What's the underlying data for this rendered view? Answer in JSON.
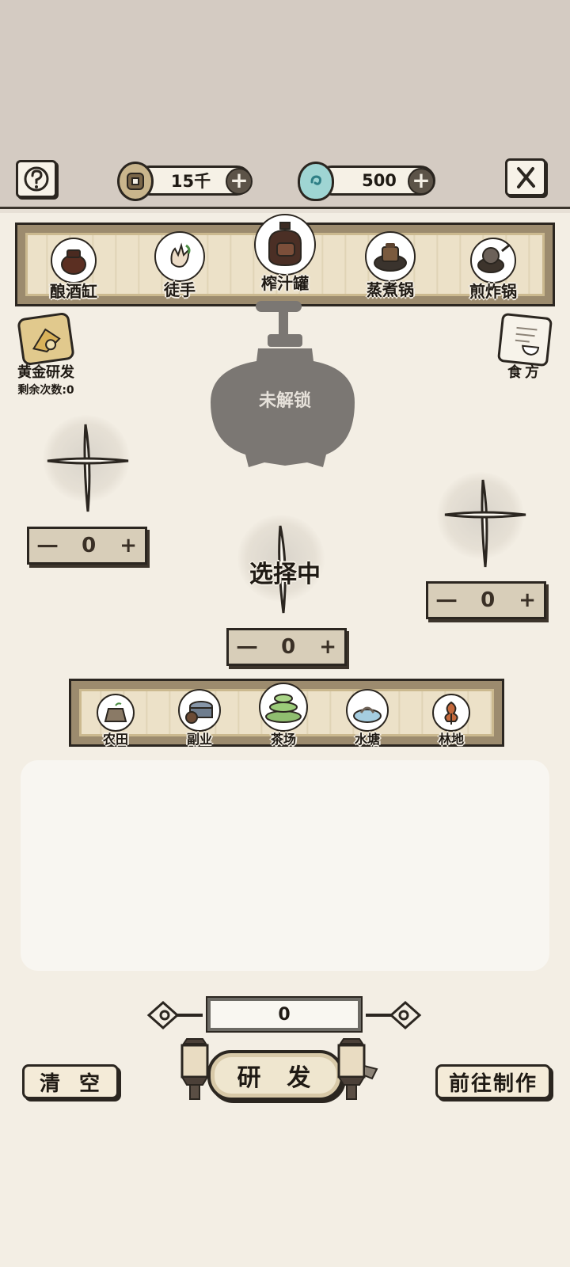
{
  "header": {
    "help_icon": "question-icon",
    "close_icon": "close-icon",
    "coins": {
      "icon": "copper-coin-icon",
      "value": "15千"
    },
    "gems": {
      "icon": "jade-egg-icon",
      "value": "500"
    }
  },
  "tools": [
    {
      "label": "酿酒缸",
      "icon": "wine-jar-icon",
      "selected": false
    },
    {
      "label": "徒手",
      "icon": "bare-hand-icon",
      "selected": false
    },
    {
      "label": "榨汁罐",
      "icon": "juice-barrel-icon",
      "selected": true
    },
    {
      "label": "蒸煮锅",
      "icon": "steamer-pot-icon",
      "selected": false
    },
    {
      "label": "煎炸锅",
      "icon": "frying-pan-icon",
      "selected": false
    }
  ],
  "golden_research": {
    "label": "黄金研发",
    "remaining": "剩余次数:0",
    "icon": "golden-scroll-icon"
  },
  "recipe": {
    "label": "食方",
    "icon": "recipe-book-icon"
  },
  "device": {
    "status": "未解锁"
  },
  "slots": [
    {
      "count": "0",
      "minus": "一",
      "plus": "+"
    },
    {
      "count": "0",
      "minus": "一",
      "plus": "+",
      "status": "选择中"
    },
    {
      "count": "0",
      "minus": "一",
      "plus": "+"
    }
  ],
  "farms": [
    {
      "label": "农田",
      "icon": "farmland-icon"
    },
    {
      "label": "副业",
      "icon": "sideline-icon"
    },
    {
      "label": "茶场",
      "icon": "tea-field-icon"
    },
    {
      "label": "水塘",
      "icon": "pond-icon"
    },
    {
      "label": "林地",
      "icon": "woodland-icon"
    }
  ],
  "quantity": "0",
  "buttons": {
    "clear": "清  空",
    "research": "研  发",
    "goto_make": "前往制作"
  },
  "colors": {
    "background": "#f3eee4",
    "top_band": "#d4cbc2",
    "device_silhouette": "#7b7773",
    "plank_border": "#9c8b6e"
  }
}
